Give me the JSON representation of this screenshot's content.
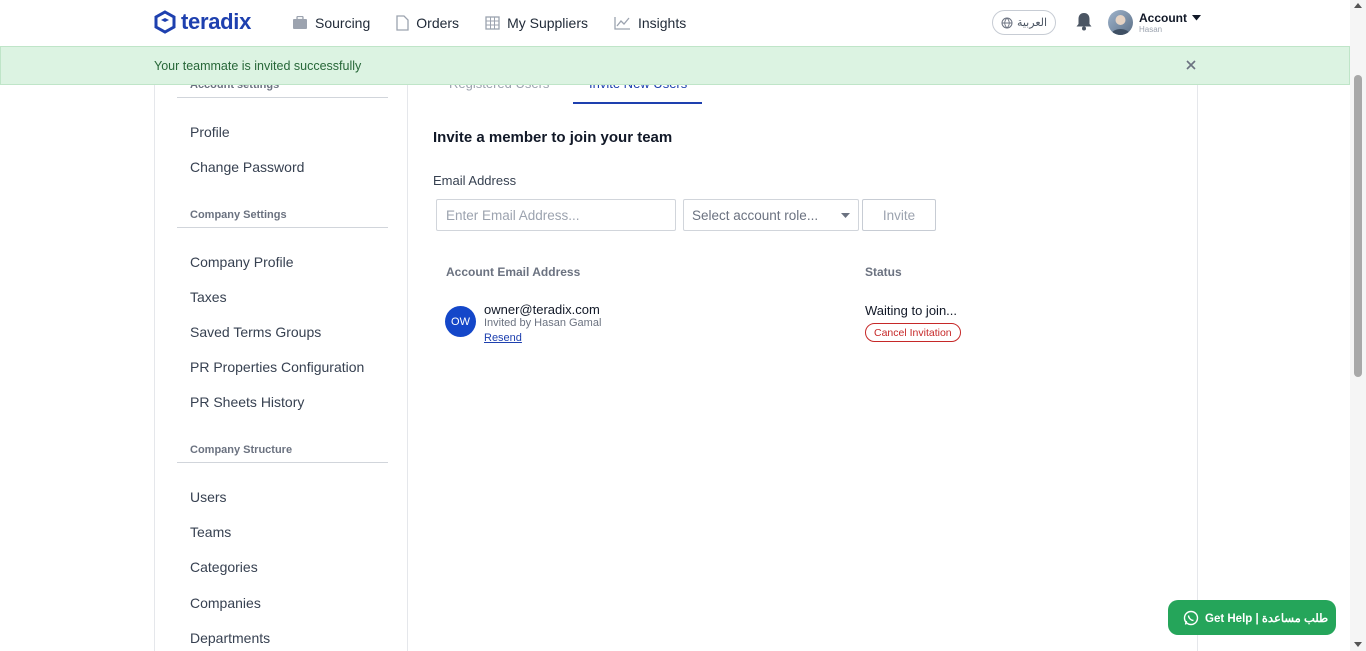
{
  "brand": {
    "name": "teradix",
    "color": "#1e40af"
  },
  "nav": [
    {
      "label": "Sourcing",
      "icon": "briefcase-icon"
    },
    {
      "label": "Orders",
      "icon": "document-icon"
    },
    {
      "label": "My Suppliers",
      "icon": "building-icon"
    },
    {
      "label": "Insights",
      "icon": "chart-line-icon"
    }
  ],
  "header": {
    "language": "العربية",
    "account_label": "Account",
    "account_user": "Hasan"
  },
  "banner": {
    "message": "Your teammate is invited successfully"
  },
  "sidebar": {
    "sections": [
      {
        "title": "Account settings",
        "items": [
          "Profile",
          "Change Password"
        ]
      },
      {
        "title": "Company Settings",
        "items": [
          "Company Profile",
          "Taxes",
          "Saved Terms Groups",
          "PR Properties Configuration",
          "PR Sheets History"
        ]
      },
      {
        "title": "Company Structure",
        "items": [
          "Users",
          "Teams",
          "Categories",
          "Companies",
          "Departments"
        ]
      }
    ]
  },
  "tabs": [
    {
      "label": "Registered Users",
      "active": false
    },
    {
      "label": "Invite New Users",
      "active": true
    }
  ],
  "invite": {
    "title": "Invite a member to join your team",
    "email_label": "Email Address",
    "email_placeholder": "Enter Email Address...",
    "role_placeholder": "Select account role...",
    "invite_button": "Invite"
  },
  "table": {
    "columns": [
      "Account Email Address",
      "Status"
    ],
    "rows": [
      {
        "initials": "OW",
        "email": "owner@teradix.com",
        "invited_by": "Invited by Hasan Gamal",
        "resend": "Resend",
        "status": "Waiting to join...",
        "cancel": "Cancel Invitation"
      }
    ]
  },
  "help": {
    "label": "Get Help | طلب مساعدة"
  },
  "colors": {
    "success_bg": "#dcf3e2",
    "danger": "#c62828",
    "whatsapp": "#25a55a"
  }
}
